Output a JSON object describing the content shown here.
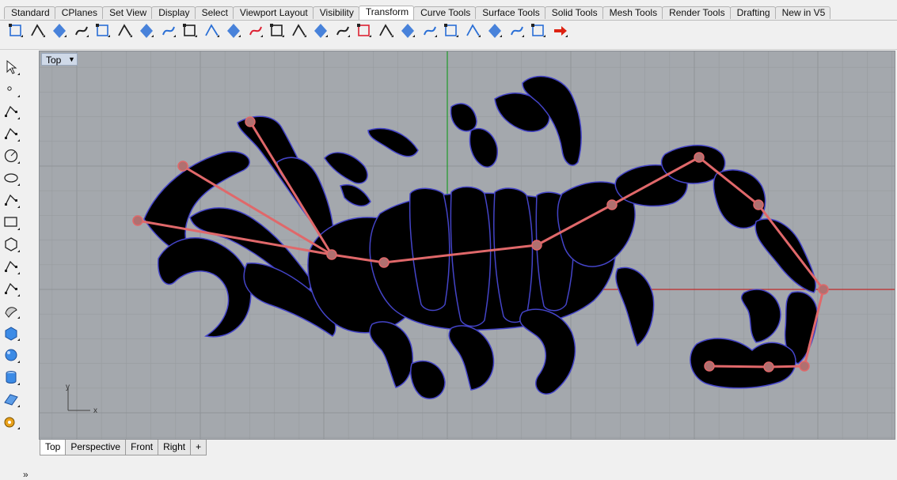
{
  "tabs": [
    {
      "label": "Standard",
      "active": false
    },
    {
      "label": "CPlanes",
      "active": false
    },
    {
      "label": "Set View",
      "active": false
    },
    {
      "label": "Display",
      "active": false
    },
    {
      "label": "Select",
      "active": false
    },
    {
      "label": "Viewport Layout",
      "active": false
    },
    {
      "label": "Visibility",
      "active": false
    },
    {
      "label": "Transform",
      "active": true
    },
    {
      "label": "Curve Tools",
      "active": false
    },
    {
      "label": "Surface Tools",
      "active": false
    },
    {
      "label": "Solid Tools",
      "active": false
    },
    {
      "label": "Mesh Tools",
      "active": false
    },
    {
      "label": "Render Tools",
      "active": false
    },
    {
      "label": "Drafting",
      "active": false
    },
    {
      "label": "New in V5",
      "active": false
    }
  ],
  "toolbar_icons": [
    "point-edit-icon",
    "curve-edit-icon",
    "control-points-icon",
    "move-icon",
    "box-icon",
    "mirror-icon",
    "diamond-icon",
    "scale-icon",
    "surface-edit-icon",
    "extend-icon",
    "plane-icon",
    "gumball-icon",
    "grid-array-icon",
    "polar-array-icon",
    "align-icon",
    "distribute-icon",
    "stack-icon",
    "bracket-icon",
    "bend-icon",
    "taper-icon",
    "twist-icon",
    "flow-icon",
    "wave-icon",
    "cage-icon",
    "cage-edit-icon",
    "arrow-right-icon"
  ],
  "left_tools": [
    "select-arrow-icon",
    "point-icon",
    "polyline-icon",
    "curve-icon",
    "circle-icon",
    "ellipse-icon",
    "arc-icon",
    "rectangle-icon",
    "polygon-icon",
    "fillet-curve-icon",
    "curve-from-object-icon",
    "surface-icon",
    "solid-box-icon",
    "sphere-icon",
    "cylinder-icon",
    "mesh-icon",
    "gear-settings-icon"
  ],
  "left_more": "»",
  "viewport": {
    "label": "Top",
    "axis_y": "y",
    "axis_x": "x",
    "colors": {
      "background": "#a4a8ad",
      "grid": "#979b9f",
      "grid_major": "#8f9398",
      "x_axis": "#c0282a",
      "y_axis": "#1e9a2a",
      "body": "#000000",
      "outline": "#4444c8",
      "bones": "#e0686a"
    }
  },
  "bottom_tabs": [
    {
      "label": "Top",
      "active": true
    },
    {
      "label": "Perspective",
      "active": false
    },
    {
      "label": "Front",
      "active": false
    },
    {
      "label": "Right",
      "active": false
    },
    {
      "label": "+",
      "active": false
    }
  ]
}
